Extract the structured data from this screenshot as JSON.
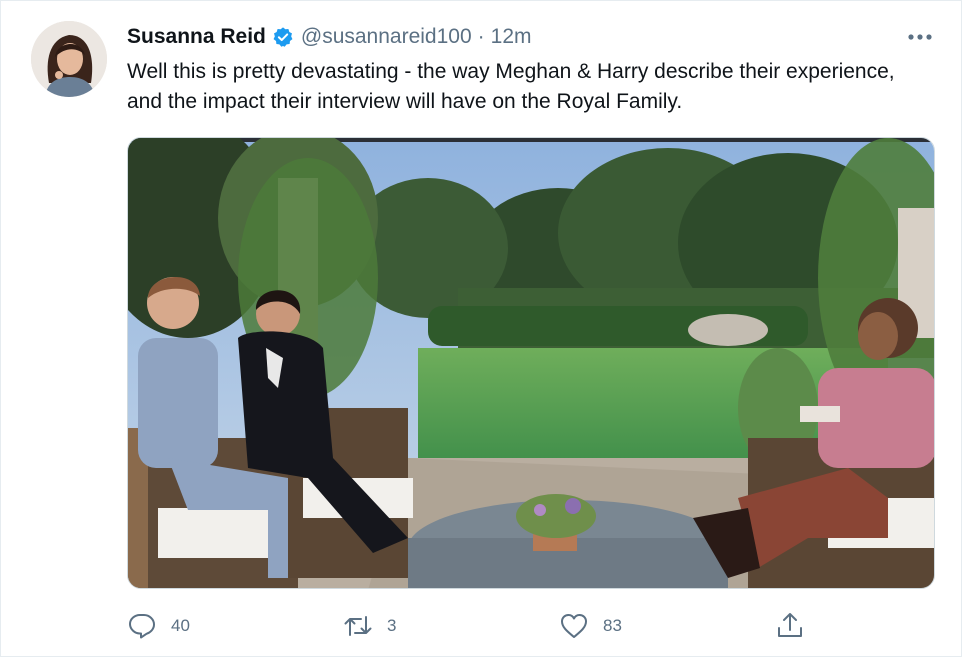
{
  "author": {
    "name": "Susanna Reid",
    "handle": "@susannareid100",
    "separator": "·",
    "time": "12m"
  },
  "tweet": {
    "text": "Well this is pretty devastating - the way Meghan & Harry describe their experience, and the impact their interview will have on the Royal Family."
  },
  "icons": {
    "verified": "verified-badge-icon",
    "more": "more-options-icon",
    "reply": "reply-icon",
    "retweet": "retweet-icon",
    "like": "like-icon",
    "share": "share-icon"
  },
  "actions": {
    "reply_count": "40",
    "retweet_count": "3",
    "like_count": "83"
  },
  "colors": {
    "verified": "#1d9bf0",
    "secondary_text": "#5b7083",
    "primary_text": "#0f1419"
  }
}
